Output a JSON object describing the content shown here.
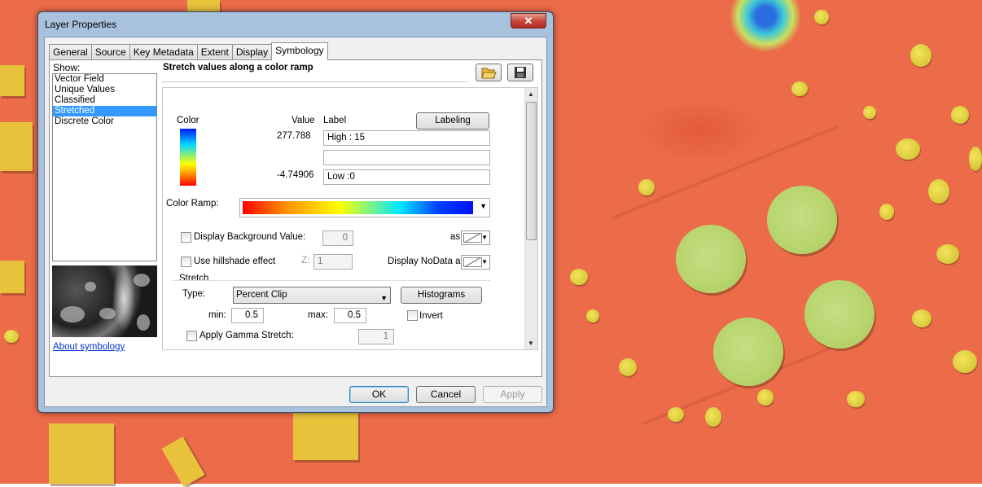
{
  "dialog": {
    "title": "Layer Properties",
    "close_glyph": "✕"
  },
  "tabs": [
    {
      "label": "General"
    },
    {
      "label": "Source"
    },
    {
      "label": "Key Metadata"
    },
    {
      "label": "Extent"
    },
    {
      "label": "Display"
    },
    {
      "label": "Symbology",
      "active": true
    }
  ],
  "show": {
    "label": "Show:",
    "items": [
      "Vector Field",
      "Unique Values",
      "Classified",
      "Stretched",
      "Discrete Color"
    ],
    "selected": "Stretched",
    "about_link": "About symbology"
  },
  "symbology": {
    "description": "Stretch values along a color ramp",
    "open_icon": "folder-open-icon",
    "save_icon": "save-disk-icon",
    "headers": {
      "color": "Color",
      "value": "Value",
      "label": "Label"
    },
    "labeling_button": "Labeling",
    "high_value": "277.788",
    "high_label": "High : 15",
    "mid_label": "",
    "low_value": "-4.74906",
    "low_label": "Low :0",
    "color_ramp_label": "Color Ramp:",
    "color_ramp_colors": [
      "#ff0000",
      "#ff8c00",
      "#ffff00",
      "#00e8ff",
      "#0040ff",
      "#0010ff"
    ],
    "display_background_label": "Display Background Value:",
    "background_value": "0",
    "as_label": "as",
    "hillshade_label": "Use hillshade effect",
    "z_label": "Z:",
    "z_value": "1",
    "nodata_label": "Display NoData as",
    "stretch": {
      "group_label": "Stretch",
      "type_label": "Type:",
      "type_value": "Percent Clip",
      "histograms_button": "Histograms",
      "min_label": "min:",
      "min_value": "0.5",
      "max_label": "max:",
      "max_value": "0.5",
      "invert_label": "Invert",
      "gamma_label": "Apply Gamma Stretch:",
      "gamma_value": "1"
    }
  },
  "buttons": {
    "ok": "OK",
    "cancel": "Cancel",
    "apply": "Apply"
  }
}
